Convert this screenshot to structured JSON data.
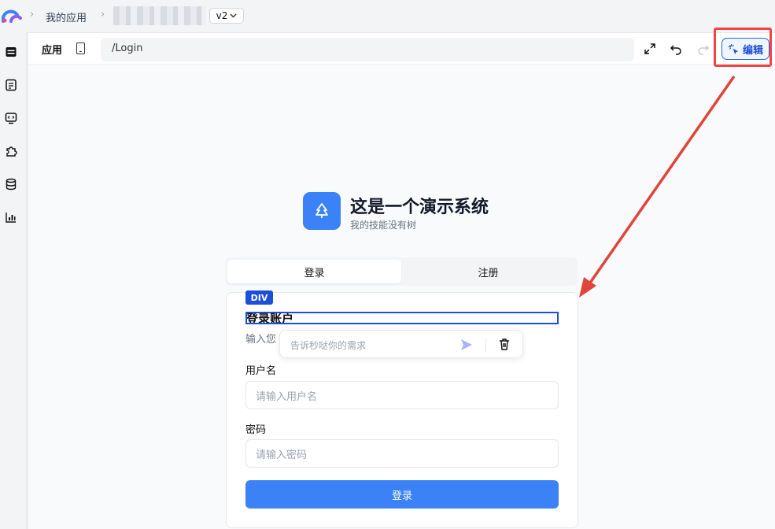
{
  "breadcrumb": {
    "app_list": "我的应用",
    "version": "v2"
  },
  "toolbar": {
    "title": "应用",
    "path": "/Login",
    "edit_label": "编辑"
  },
  "brand": {
    "title": "这是一个演示系统",
    "subtitle": "我的技能没有树"
  },
  "tabs": [
    {
      "label": "登录",
      "active": true
    },
    {
      "label": "注册",
      "active": false
    }
  ],
  "card": {
    "badge": "DIV",
    "heading": "登录账户",
    "description": "输入您",
    "ai_prompt_placeholder": "告诉秒哒你的需求",
    "username_label": "用户名",
    "username_placeholder": "请输入用户名",
    "password_label": "密码",
    "password_placeholder": "请输入密码",
    "submit_label": "登录"
  },
  "colors": {
    "accent": "#3b82f6",
    "highlight": "#ef4444",
    "selection": "#1d4ed8"
  },
  "icons": [
    "logo-icon",
    "chevron-right-icon",
    "chevron-down-icon",
    "pages-icon",
    "document-icon",
    "code-icon",
    "plugin-icon",
    "database-icon",
    "analytics-icon",
    "mobile-device-icon",
    "fullscreen-icon",
    "undo-icon",
    "redo-icon",
    "ai-edit-icon",
    "tree-icon",
    "send-icon",
    "trash-icon"
  ]
}
